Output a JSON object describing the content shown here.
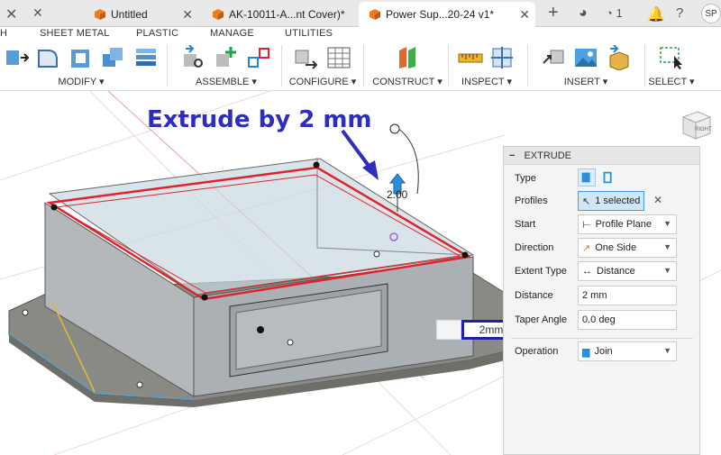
{
  "tabs": [
    {
      "label": "Untitled",
      "active": false
    },
    {
      "label": "AK-10011-A...nt Cover)*",
      "active": false
    },
    {
      "label": "Power Sup...20-24 v1*",
      "active": true
    }
  ],
  "tabbar": {
    "job_count": "1",
    "user_initials": "SP"
  },
  "menu": {
    "h": "H",
    "sheet_metal": "SHEET METAL",
    "plastic": "PLASTIC",
    "manage": "MANAGE",
    "utilities": "UTILITIES"
  },
  "toolbar": {
    "modify": "MODIFY",
    "assemble": "ASSEMBLE",
    "configure": "CONFIGURE",
    "construct": "CONSTRUCT",
    "inspect": "INSPECT",
    "insert": "INSERT",
    "select": "SELECT"
  },
  "annotation": {
    "text": "Extrude by 2 mm",
    "color": "#2d2dbf"
  },
  "manipulator": {
    "value_label": "2.00",
    "box_value": "2mm"
  },
  "viewcube": {
    "face": "RIGHT",
    "axis": "Z"
  },
  "panel": {
    "title": "EXTRUDE",
    "type_label": "Type",
    "profiles_label": "Profiles",
    "profiles_value": "1 selected",
    "start_label": "Start",
    "start_value": "Profile Plane",
    "direction_label": "Direction",
    "direction_value": "One Side",
    "extent_label": "Extent Type",
    "extent_value": "Distance",
    "distance_label": "Distance",
    "distance_value": "2 mm",
    "taper_label": "Taper Angle",
    "taper_value": "0.0 deg",
    "operation_label": "Operation",
    "operation_value": "Join"
  },
  "colors": {
    "accent": "#0696d7",
    "highlight_edge": "#e0222a",
    "selection": "#cfe7fb",
    "orange_cube": "#f07b1b"
  }
}
